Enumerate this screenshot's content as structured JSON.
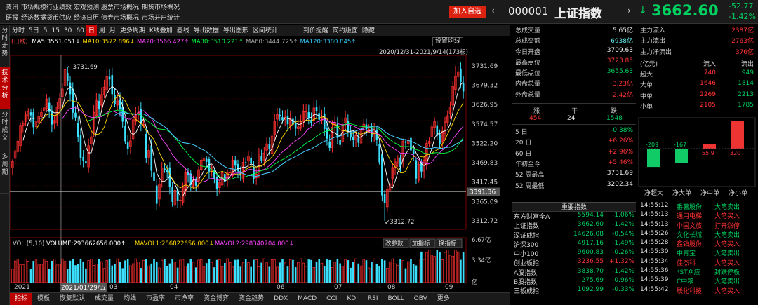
{
  "nav": {
    "row1": [
      "资讯",
      "市场规模",
      "行业绩效",
      "宏观预测",
      "股票市场概况",
      "期货市场概况"
    ],
    "row2": [
      "研报",
      "经济数据",
      "货币供应",
      "经济日历",
      "债券市场概况",
      "市场开户统计"
    ]
  },
  "header": {
    "add_watch": "加入自选",
    "code": "000001",
    "name": "上证指数",
    "price": "3662.60",
    "change": "-52.77",
    "change_pct": "-1.42%"
  },
  "toolbar": [
    "分时",
    "5日",
    "5",
    "15",
    "30",
    "60",
    "日",
    "周",
    "月",
    "更多周期",
    "K线叠加",
    "画线",
    "导出数据",
    "导出图形",
    "区间统计",
    "到价提醒",
    "简约版面",
    "隐藏"
  ],
  "toolbar_active": "日",
  "left_rail": [
    {
      "label": "分时走势",
      "active": false
    },
    {
      "label": "技术分析",
      "active": true
    },
    {
      "label": "分时成交",
      "active": false
    },
    {
      "label": "多周期",
      "active": false
    }
  ],
  "ma_legend": {
    "prefix": "(日线)",
    "items": [
      {
        "text": "MA5:3551.051↓",
        "color": "#ffffff"
      },
      {
        "text": "MA10:3572.896↓",
        "color": "#ffd700"
      },
      {
        "text": "MA20:3566.427↑",
        "color": "#ff44ff"
      },
      {
        "text": "MA30:3510.221↑",
        "color": "#00ff44"
      },
      {
        "text": "MA60:3444.725↑",
        "color": "#aaaaaa"
      },
      {
        "text": "MA120:3380.845↑",
        "color": "#33ccff"
      }
    ],
    "setting": "设置均线",
    "range": "2020/12/31-2021/9/14(173根)"
  },
  "price_axis": [
    "3731.69",
    "3679.32",
    "3626.95",
    "3574.57",
    "3522.20",
    "3469.83",
    "3417.45",
    "3365.09",
    "3312.72"
  ],
  "price_cursor": "3391.36",
  "annotations": {
    "high": "3731.69",
    "low": "3312.72"
  },
  "vol": {
    "label": "VOL (5,10)",
    "volume": "VOLUME:293662656.000↑",
    "mavol1": "MAVOL1:286822656.000↓",
    "mavol2": "MAVOL2:298340704.000↓",
    "btn_param": "改参数",
    "btn_add": "加指标",
    "btn_switch": "换指标",
    "axis": [
      "6.67亿",
      "3.34亿",
      "亿"
    ]
  },
  "x_axis": [
    "2021",
    "02",
    "03",
    "04",
    "",
    "06",
    "07",
    "08",
    "09"
  ],
  "x_cursor": "2021/01/29/五",
  "bottom_tabs": [
    "指标",
    "模板",
    "恢复默认",
    "成交量",
    "均线",
    "市盈率",
    "市净率",
    "资金博弈",
    "资金趋势",
    "DDX",
    "MACD",
    "CCI",
    "KDJ",
    "RSI",
    "BOLL",
    "OBV",
    "更多"
  ],
  "bottom_active": "指标",
  "info": [
    {
      "label": "总成交量",
      "value": "5.65亿",
      "color": "#eeeeee"
    },
    {
      "label": "总成交额",
      "value": "6938亿",
      "color": "#5eeeee"
    },
    {
      "label": "今日开盘",
      "value": "3709.63",
      "color": "#eeeeee"
    },
    {
      "label": "最高点位",
      "value": "3723.85",
      "color": "#ff3333"
    },
    {
      "label": "最低点位",
      "value": "3655.63",
      "color": "#00d060"
    },
    {
      "label": "内盘总量",
      "value": "3.23亿",
      "color": "#ff3333"
    },
    {
      "label": "外盘总量",
      "value": "2.42亿",
      "color": "#ff3333"
    }
  ],
  "breadth": {
    "labels": [
      "涨",
      "平",
      "跌"
    ],
    "values": [
      "454",
      "24",
      "1548"
    ]
  },
  "returns": [
    {
      "label": "5 日",
      "value": "-0.38%",
      "color": "#00d060"
    },
    {
      "label": "20 日",
      "value": "+6.26%",
      "color": "#ff3333"
    },
    {
      "label": "60 日",
      "value": "+2.96%",
      "color": "#ff3333"
    },
    {
      "label": "年初至今",
      "value": "+5.46%",
      "color": "#ff3333"
    },
    {
      "label": "52 周最高",
      "value": "3731.69",
      "color": "#eeeeee"
    },
    {
      "label": "52 周最低",
      "value": "3202.34",
      "color": "#eeeeee"
    }
  ],
  "flow": [
    {
      "label": "主力流入",
      "value": "2387亿"
    },
    {
      "label": "主力流出",
      "value": "2763亿"
    },
    {
      "label": "主力净流出",
      "value": "376亿"
    }
  ],
  "flow_table": {
    "header": [
      "(亿元)",
      "流入",
      "流出"
    ],
    "rows": [
      [
        "超大",
        "740",
        "949"
      ],
      [
        "大单",
        "1646",
        "1814"
      ],
      [
        "中单",
        "2269",
        "2213"
      ],
      [
        "小单",
        "2105",
        "1785"
      ]
    ]
  },
  "net_bars": {
    "values": [
      -209,
      -167,
      55.9,
      320
    ],
    "labels": [
      "-209",
      "-167",
      "55.9",
      "320"
    ],
    "names": [
      "净超大",
      "净大单",
      "净中单",
      "净小单"
    ]
  },
  "idx_title": "重要指数",
  "indices": [
    {
      "name": "东方财富全A",
      "price": "5594.14",
      "pct": "-1.06%",
      "color": "#00d060"
    },
    {
      "name": "上证指数",
      "price": "3662.60",
      "pct": "-1.42%",
      "color": "#00d060"
    },
    {
      "name": "深证成指",
      "price": "14626.08",
      "pct": "-0.54%",
      "color": "#00d060"
    },
    {
      "name": "沪深300",
      "price": "4917.16",
      "pct": "-1.49%",
      "color": "#00d060"
    },
    {
      "name": "中小100",
      "price": "9600.83",
      "pct": "-0.26%",
      "color": "#00d060"
    },
    {
      "name": "创业板指",
      "price": "3236.55",
      "pct": "+1.32%",
      "color": "#ff3333"
    },
    {
      "name": "A股指数",
      "price": "3838.70",
      "pct": "-1.42%",
      "color": "#00d060"
    },
    {
      "name": "B股指数",
      "price": "275.69",
      "pct": "-0.96%",
      "color": "#00d060"
    },
    {
      "name": "三板成指",
      "price": "1092.99",
      "pct": "-0.33%",
      "color": "#00d060"
    }
  ],
  "ticks": [
    {
      "time": "14:55:12",
      "name": "番薯股份",
      "action": "大笔卖出",
      "color": "#00d060"
    },
    {
      "time": "14:55:13",
      "name": "通用电梯",
      "action": "大笔买入",
      "color": "#ff3333"
    },
    {
      "time": "14:55:13",
      "name": "中国文旅",
      "action": "打开涨停",
      "color": "#ff3333"
    },
    {
      "time": "14:55:26",
      "name": "文化长城",
      "action": "大笔卖出",
      "color": "#00d060"
    },
    {
      "time": "14:55:28",
      "name": "鑫铂股份",
      "action": "大笔买入",
      "color": "#ff3333"
    },
    {
      "time": "14:55:30",
      "name": "中青宝",
      "action": "大笔卖出",
      "color": "#00d060"
    },
    {
      "time": "14:55:34",
      "name": "佳杰科",
      "action": "大笔买入",
      "color": "#ff3333"
    },
    {
      "time": "14:55:36",
      "name": "*ST众应",
      "action": "封跌停板",
      "color": "#00d060"
    },
    {
      "time": "14:55:39",
      "name": "C中粮",
      "action": "大笔卖出",
      "color": "#00d060"
    },
    {
      "time": "14:55:42",
      "name": "联化科技",
      "action": "大笔买入",
      "color": "#ff3333"
    }
  ],
  "chart_data": {
    "type": "candlestick",
    "title": "上证指数",
    "range": "2020/12/31-2021/9/14",
    "ylim": [
      3290,
      3760
    ],
    "high": 3731.69,
    "low": 3312.72,
    "last_close": 3662.6,
    "ma_values": {
      "MA5": 3551.051,
      "MA10": 3572.896,
      "MA20": 3566.427,
      "MA30": 3510.221,
      "MA60": 3444.725,
      "MA120": 3380.845
    },
    "closes": [
      3473,
      3502,
      3528,
      3571,
      3576,
      3599,
      3608,
      3598,
      3566,
      3583,
      3595,
      3606,
      3618,
      3642,
      3607,
      3573,
      3584,
      3620,
      3643,
      3669,
      3721,
      3690,
      3655,
      3605,
      3592,
      3540,
      3483,
      3474,
      3470,
      3516,
      3540,
      3606,
      3640,
      3614,
      3654,
      3674,
      3702,
      3695,
      3655,
      3628,
      3637,
      3614,
      3581,
      3528,
      3508,
      3529,
      3586,
      3601,
      3605,
      3574,
      3574,
      3482,
      3503,
      3448,
      3421,
      3359,
      3412,
      3456,
      3450,
      3445,
      3404,
      3364,
      3395,
      3367,
      3369,
      3404,
      3443,
      3436,
      3410,
      3425,
      3408,
      3451,
      3477,
      3480,
      3472,
      3446,
      3457,
      3426,
      3399,
      3416,
      3443,
      3419,
      3442,
      3445,
      3477,
      3462,
      3448,
      3435,
      3471,
      3470,
      3488,
      3467,
      3426,
      3439,
      3494,
      3476,
      3496,
      3521,
      3506,
      3542,
      3583,
      3600,
      3595,
      3585,
      3593,
      3574,
      3590,
      3573,
      3562,
      3567,
      3580,
      3608,
      3609,
      3589,
      3576,
      3618,
      3610,
      3586,
      3593,
      3561,
      3535,
      3510,
      3566,
      3579,
      3537,
      3518,
      3573,
      3591,
      3554,
      3538,
      3531,
      3543,
      3524,
      3559,
      3574,
      3560,
      3560,
      3539,
      3564,
      3532,
      3471,
      3382,
      3361,
      3397,
      3413,
      3457,
      3472,
      3482,
      3458,
      3528,
      3524,
      3531,
      3503,
      3494,
      3427,
      3465,
      3446,
      3477,
      3522,
      3528,
      3567,
      3581,
      3543,
      3521,
      3555,
      3580,
      3597,
      3621,
      3676,
      3703,
      3716,
      3688,
      3662.6
    ],
    "volume_axis_max": "6.67亿"
  }
}
